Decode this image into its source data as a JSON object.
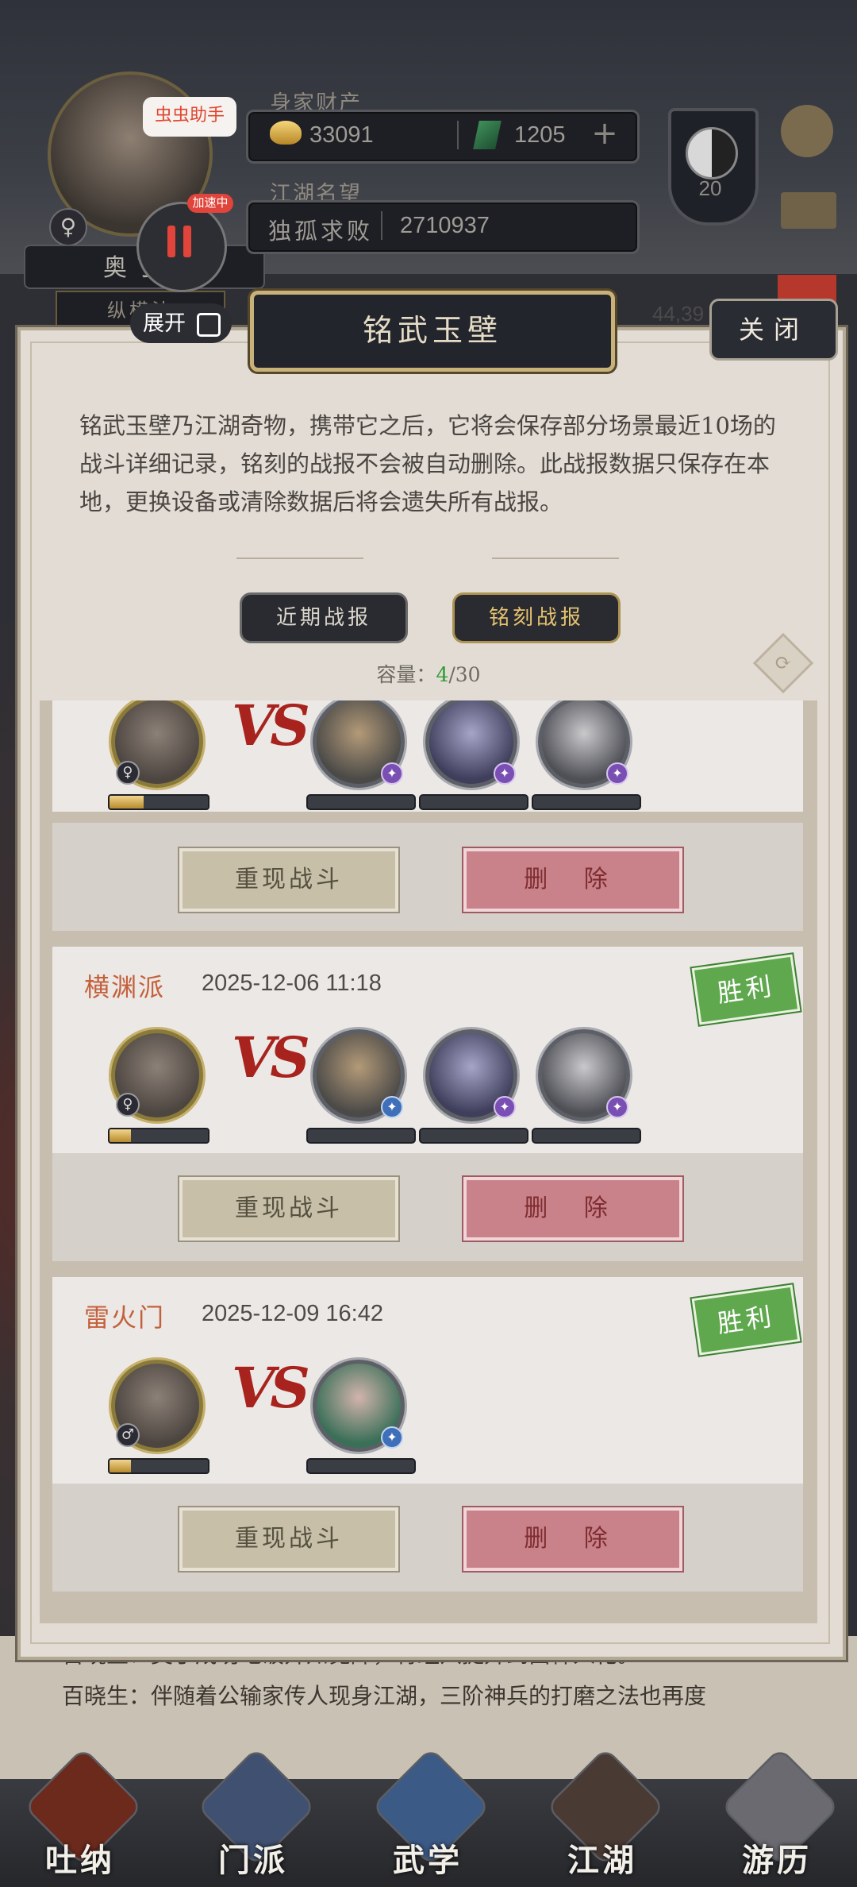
{
  "hud": {
    "wealth_label": "身家财产",
    "gold": "33091",
    "jade": "1205",
    "fame_label": "江湖名望",
    "title_name": "独孤求败",
    "fame": "2710937",
    "player_name": "奥丁",
    "faction_tag": "纵横沐",
    "level": "20",
    "gender_symbol": "♀",
    "hidden_stat": "44,39"
  },
  "overlay": {
    "helper_label": "虫虫助手",
    "accel_label": "加速中",
    "expand_label": "展开"
  },
  "panel": {
    "title": "铭武玉壁",
    "close_label": "关闭",
    "description": "铭武玉壁乃江湖奇物，携带它之后，它将会保存部分场景最近10场的战斗详细记录，铭刻的战报不会被自动删除。此战报数据只保存在本地，更换设备或清除数据后将会遗失所有战报。",
    "tabs": [
      "近期战报",
      "铭刻战报"
    ],
    "capacity_label": "容量：",
    "capacity_used": "4",
    "capacity_total": "/30",
    "replay_label": "重现战斗",
    "delete_label": "删 除",
    "vs": "VS"
  },
  "battles": [
    {
      "sect": "",
      "date": "",
      "result": "",
      "hp_fraction": 0.35,
      "opponents": 3
    },
    {
      "sect": "横渊派",
      "date": "2025-12-06 11:18",
      "result": "胜利",
      "hp_fraction": 0.22,
      "opponents": 3
    },
    {
      "sect": "雷火门",
      "date": "2025-12-09 16:42",
      "result": "胜利",
      "hp_fraction": 0.22,
      "opponents": 1
    }
  ],
  "news": [
    "百晓生：奥丁成功地破开知觉障，将经穴提升到由神入化。",
    "百晓生：伴随着公输家传人现身江湖，三阶神兵的打磨之法也再度"
  ],
  "nav": [
    "吐纳",
    "门派",
    "武学",
    "江湖",
    "游历"
  ],
  "colors": {
    "accent": "#c4603a",
    "victory": "#5fa84e",
    "delete": "#c9828a",
    "capacity_used": "#2f9b32"
  }
}
